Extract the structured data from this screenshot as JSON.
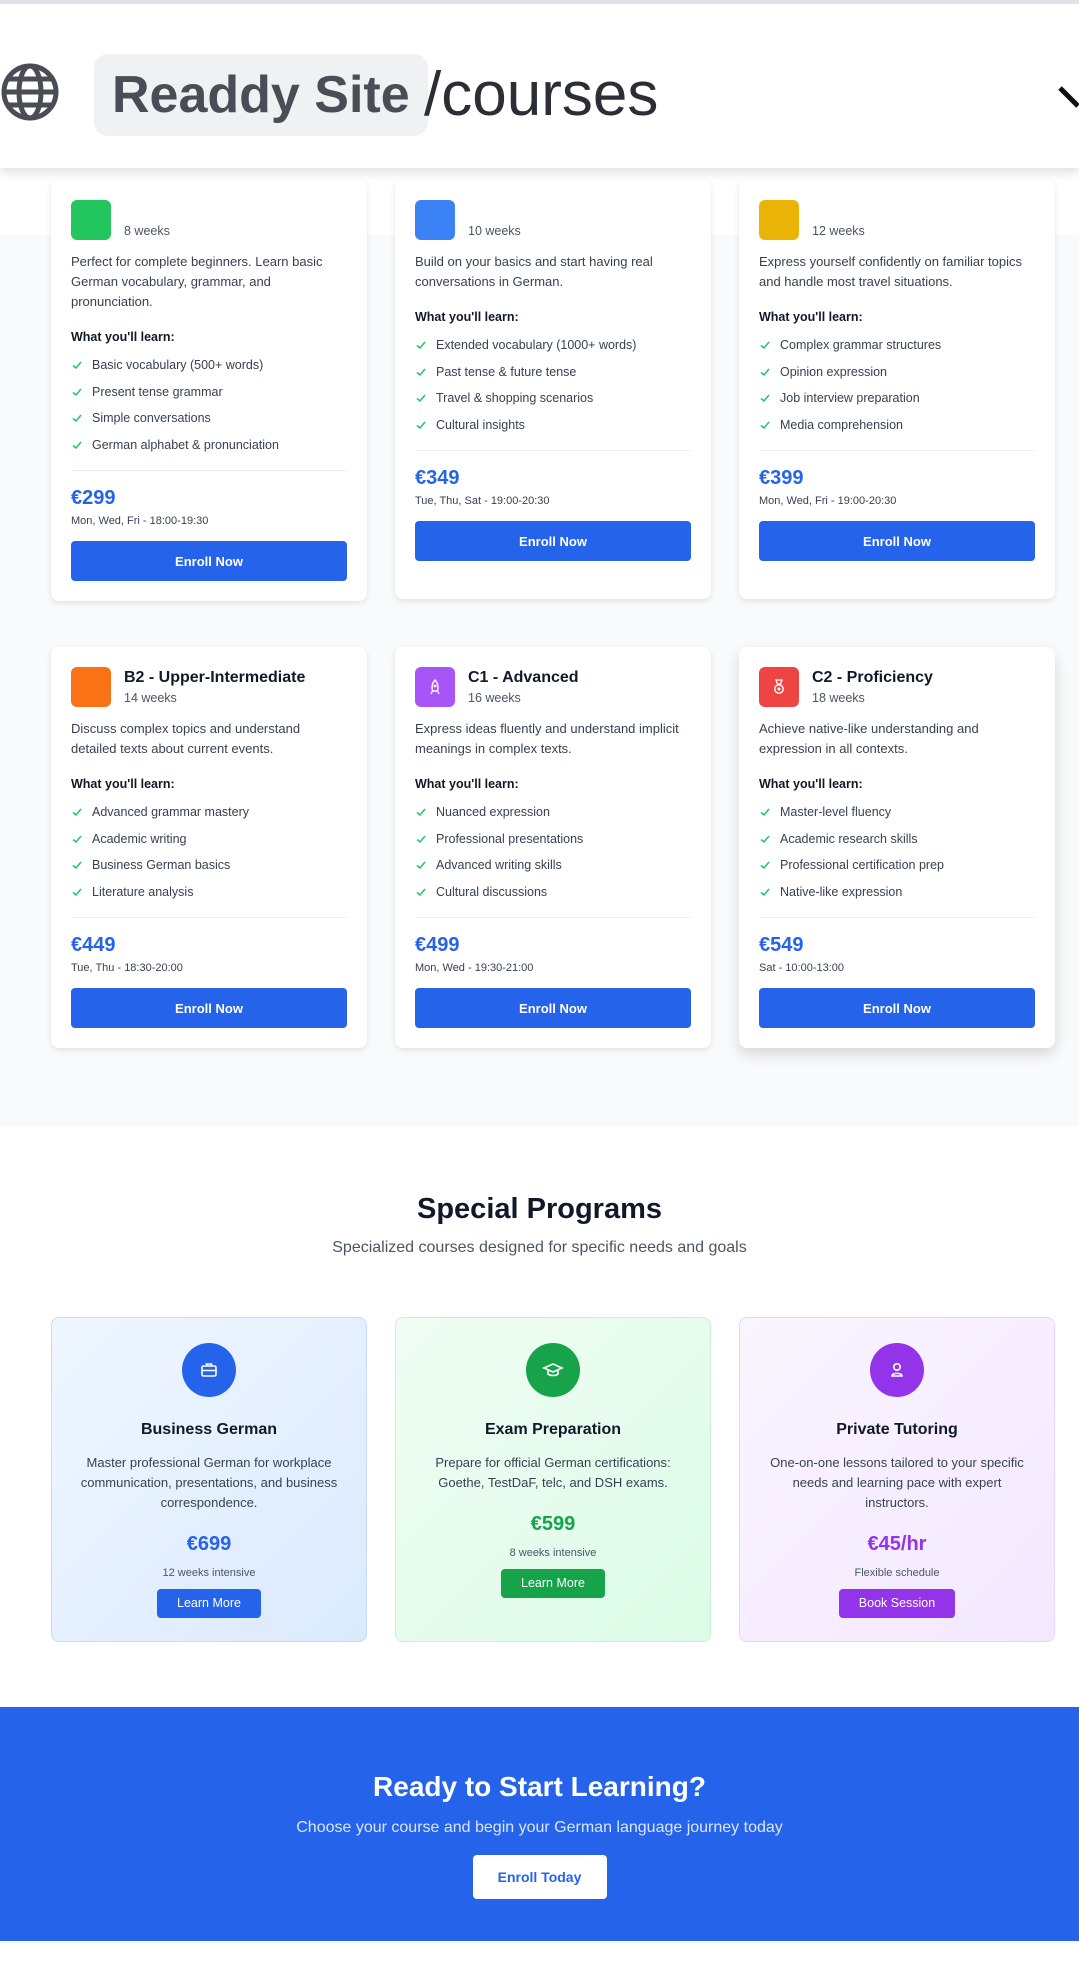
{
  "browser": {
    "site_name": "Readdy Site",
    "path": "/courses"
  },
  "levels": [
    {
      "weeks": "8 weeks",
      "color": "#22c55e",
      "description": "Perfect for complete beginners. Learn basic German vocabulary, grammar, and pronunciation.",
      "learn_heading": "What you'll learn:",
      "items": [
        "Basic vocabulary (500+ words)",
        "Present tense grammar",
        "Simple conversations",
        "German alphabet & pronunciation"
      ],
      "price": "€299",
      "schedule": "Mon, Wed, Fri - 18:00-19:30",
      "enroll_label": "Enroll Now"
    },
    {
      "weeks": "10 weeks",
      "color": "#3b82f6",
      "description": "Build on your basics and start having real conversations in German.",
      "learn_heading": "What you'll learn:",
      "items": [
        "Extended vocabulary (1000+ words)",
        "Past tense & future tense",
        "Travel & shopping scenarios",
        "Cultural insights"
      ],
      "price": "€349",
      "schedule": "Tue, Thu, Sat - 19:00-20:30",
      "enroll_label": "Enroll Now"
    },
    {
      "weeks": "12 weeks",
      "color": "#eab308",
      "description": "Express yourself confidently on familiar topics and handle most travel situations.",
      "learn_heading": "What you'll learn:",
      "items": [
        "Complex grammar structures",
        "Opinion expression",
        "Job interview preparation",
        "Media comprehension"
      ],
      "price": "€399",
      "schedule": "Mon, Wed, Fri - 19:00-20:30",
      "enroll_label": "Enroll Now"
    },
    {
      "title": "B2 - Upper-Intermediate",
      "weeks": "14 weeks",
      "color": "#f97316",
      "icon": "blank-icon",
      "description": "Discuss complex topics and understand detailed texts about current events.",
      "learn_heading": "What you'll learn:",
      "items": [
        "Advanced grammar mastery",
        "Academic writing",
        "Business German basics",
        "Literature analysis"
      ],
      "price": "€449",
      "schedule": "Tue, Thu - 18:30-20:00",
      "enroll_label": "Enroll Now"
    },
    {
      "title": "C1 - Advanced",
      "weeks": "16 weeks",
      "color": "#a855f7",
      "icon": "rocket-icon",
      "description": "Express ideas fluently and understand implicit meanings in complex texts.",
      "learn_heading": "What you'll learn:",
      "items": [
        "Nuanced expression",
        "Professional presentations",
        "Advanced writing skills",
        "Cultural discussions"
      ],
      "price": "€499",
      "schedule": "Mon, Wed - 19:30-21:00",
      "enroll_label": "Enroll Now"
    },
    {
      "title": "C2 - Proficiency",
      "weeks": "18 weeks",
      "color": "#ef4444",
      "icon": "medal-icon",
      "description": "Achieve native-like understanding and expression in all contexts.",
      "learn_heading": "What you'll learn:",
      "items": [
        "Master-level fluency",
        "Academic research skills",
        "Professional certification prep",
        "Native-like expression"
      ],
      "price": "€549",
      "schedule": "Sat - 10:00-13:00",
      "enroll_label": "Enroll Now"
    }
  ],
  "programs": {
    "title": "Special Programs",
    "subtitle": "Specialized courses designed for specific needs and goals",
    "items": [
      {
        "title": "Business German",
        "icon": "briefcase-icon",
        "color": "#2563eb",
        "description": "Master professional German for workplace communication, presentations, and business correspondence.",
        "price": "€699",
        "note": "12 weeks intensive",
        "button": "Learn More"
      },
      {
        "title": "Exam Preparation",
        "icon": "graduation-cap-icon",
        "color": "#16a34a",
        "description": "Prepare for official German certifications: Goethe, TestDaF, telc, and DSH exams.",
        "price": "€599",
        "note": "8 weeks intensive",
        "button": "Learn More"
      },
      {
        "title": "Private Tutoring",
        "icon": "user-icon",
        "color": "#9333ea",
        "description": "One-on-one lessons tailored to your specific needs and learning pace with expert instructors.",
        "price": "€45/hr",
        "note": "Flexible schedule",
        "button": "Book Session"
      }
    ]
  },
  "cta": {
    "title": "Ready to Start Learning?",
    "subtitle": "Choose your course and begin your German language journey today",
    "button": "Enroll Today"
  }
}
